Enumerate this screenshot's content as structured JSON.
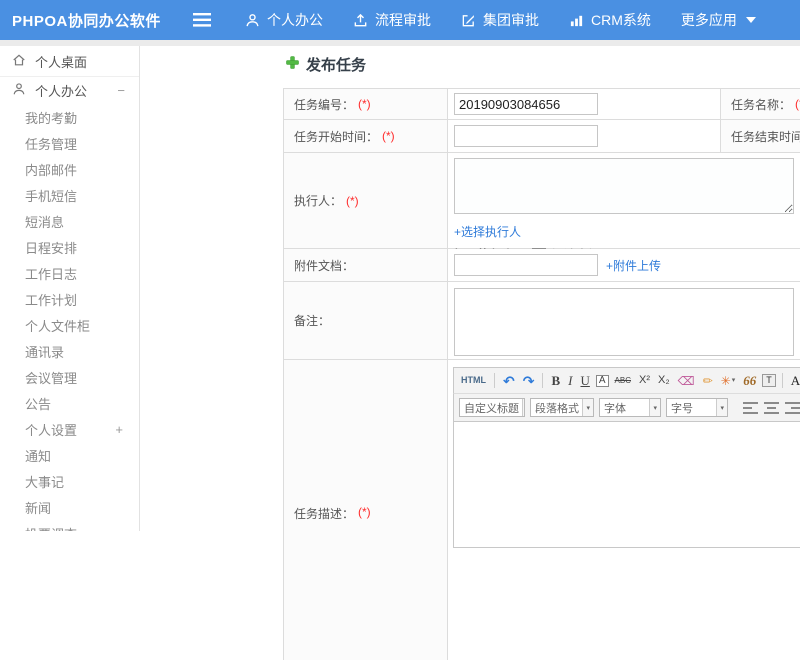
{
  "topbar": {
    "logo": "PHPOA协同办公软件",
    "nav": [
      {
        "label": "个人办公"
      },
      {
        "label": "流程审批"
      },
      {
        "label": "集团审批"
      },
      {
        "label": "CRM系统"
      },
      {
        "label": "更多应用"
      }
    ]
  },
  "sidebar": {
    "desktop_label": "个人桌面",
    "group_label": "个人办公",
    "group_toggle": "−",
    "settings_toggle": "+",
    "items": [
      "我的考勤",
      "任务管理",
      "内部邮件",
      "手机短信",
      "短消息",
      "日程安排",
      "工作日志",
      "工作计划",
      "个人文件柜",
      "通讯录",
      "会议管理",
      "公告",
      "个人设置",
      "通知",
      "大事记",
      "新闻",
      "投票调查"
    ]
  },
  "main": {
    "title": "发布任务",
    "form": {
      "required_mark": "(*)",
      "task_no_label": "任务编号：",
      "task_no_value": "20190903084656",
      "task_name_label": "任务名称：",
      "start_time_label": "任务开始时间：",
      "end_time_label": "任务结束时间：",
      "executor_label": "执行人：",
      "choose_executor_link": "+选择执行人",
      "remind_label": "提醒执行人：",
      "checkmark": "✔",
      "sms_option_label": "短消息提示",
      "attachment_label": "附件文档：",
      "attachment_upload_link": "+附件上传",
      "remark_label": "备注：",
      "desc_label": "任务描述："
    },
    "editor": {
      "html": "HTML",
      "undo": "↶",
      "redo": "↷",
      "bold": "B",
      "italic": "I",
      "underline": "U",
      "font_box": "A",
      "strike": "ABC",
      "sup": "X²",
      "sub": "X₂",
      "eraser": "⌫",
      "brush": "✏",
      "magic": "✳",
      "caret": "▾",
      "quote": "66",
      "paste": "T",
      "font_color": "A",
      "selects": [
        "自定义标题",
        "段落格式",
        "字体",
        "字号"
      ]
    }
  },
  "colors": {
    "topbar_blue": "#4a90e2",
    "link_blue": "#2f7bd9",
    "required_red": "#fe2b2b",
    "plus_green": "#52b944"
  }
}
